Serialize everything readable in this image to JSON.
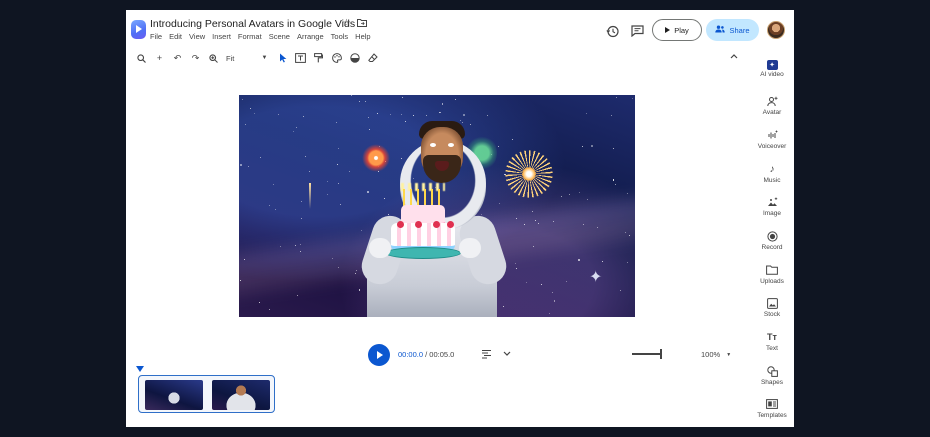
{
  "header": {
    "title": "Introducing Personal Avatars in Google Vids",
    "menu": [
      "File",
      "Edit",
      "View",
      "Insert",
      "Format",
      "Scene",
      "Arrange",
      "Tools",
      "Help"
    ],
    "play_label": "Play",
    "share_label": "Share"
  },
  "toolbar": {
    "zoom_label": "Fit"
  },
  "playback": {
    "current_time": "00:00.0",
    "separator": " / ",
    "total_time": "00:05.0",
    "zoom_percent": "100%"
  },
  "sidebar": {
    "items": [
      {
        "label": "AI video",
        "icon": "ai-video-icon"
      },
      {
        "label": "Avatar",
        "icon": "avatar-icon"
      },
      {
        "label": "Voiceover",
        "icon": "voiceover-icon"
      },
      {
        "label": "Music",
        "icon": "music-icon"
      },
      {
        "label": "Image",
        "icon": "image-icon"
      },
      {
        "label": "Record",
        "icon": "record-icon"
      },
      {
        "label": "Uploads",
        "icon": "uploads-icon"
      },
      {
        "label": "Stock",
        "icon": "stock-icon"
      },
      {
        "label": "Text",
        "icon": "text-icon"
      },
      {
        "label": "Shapes",
        "icon": "shapes-icon"
      },
      {
        "label": "Templates",
        "icon": "templates-icon"
      }
    ]
  },
  "colors": {
    "accent": "#0b57d0",
    "share_bg": "#c2e7ff",
    "outer_bg": "#0f1522"
  }
}
